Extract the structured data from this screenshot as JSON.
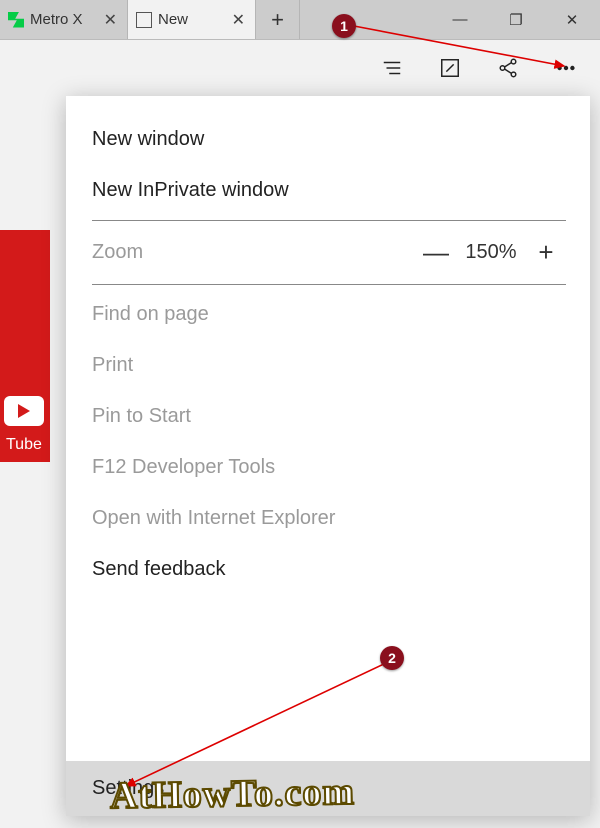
{
  "tabs": [
    {
      "favicon": "deviantart",
      "title": "Metro X"
    },
    {
      "favicon": "page",
      "title": "New"
    }
  ],
  "window_controls": {
    "minimize": "—",
    "maximize": "❐",
    "close": "✕"
  },
  "toolbar_icons": [
    "reading-list",
    "note",
    "share",
    "more"
  ],
  "sidebar_tile": {
    "label": "Tube"
  },
  "menu": {
    "new_window": "New window",
    "new_inprivate": "New InPrivate window",
    "zoom_label": "Zoom",
    "zoom_value": "150%",
    "find": "Find on page",
    "print": "Print",
    "pin": "Pin to Start",
    "devtools": "F12 Developer Tools",
    "open_ie": "Open with Internet Explorer",
    "feedback": "Send feedback",
    "settings": "Settings"
  },
  "annotations": {
    "callout1": "1",
    "callout2": "2",
    "watermark": "AtHowTo.com"
  }
}
